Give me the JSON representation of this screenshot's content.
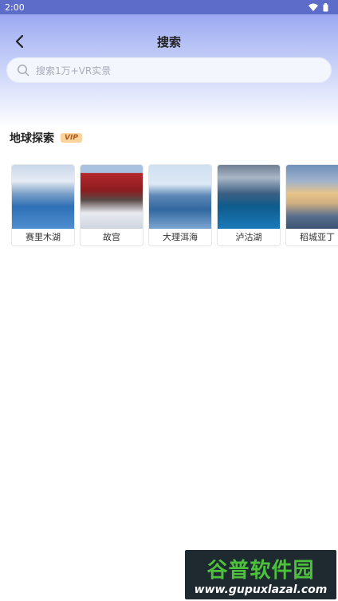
{
  "status_bar": {
    "time": "2:00"
  },
  "header": {
    "title": "搜索"
  },
  "search": {
    "placeholder": "搜索1万+VR实景"
  },
  "section": {
    "title": "地球探索",
    "badge": "VIP"
  },
  "cards": [
    {
      "label": "赛里木湖"
    },
    {
      "label": "故宫"
    },
    {
      "label": "大理洱海"
    },
    {
      "label": "泸沽湖"
    },
    {
      "label": "稻城亚丁"
    }
  ],
  "watermark": {
    "logo_text": "谷普软件园",
    "url": "www.gupuxlazal.com"
  },
  "colors": {
    "status_bar": "#5d6cc9",
    "vip_bg": "#fbd39d",
    "vip_text": "#b2591b"
  }
}
